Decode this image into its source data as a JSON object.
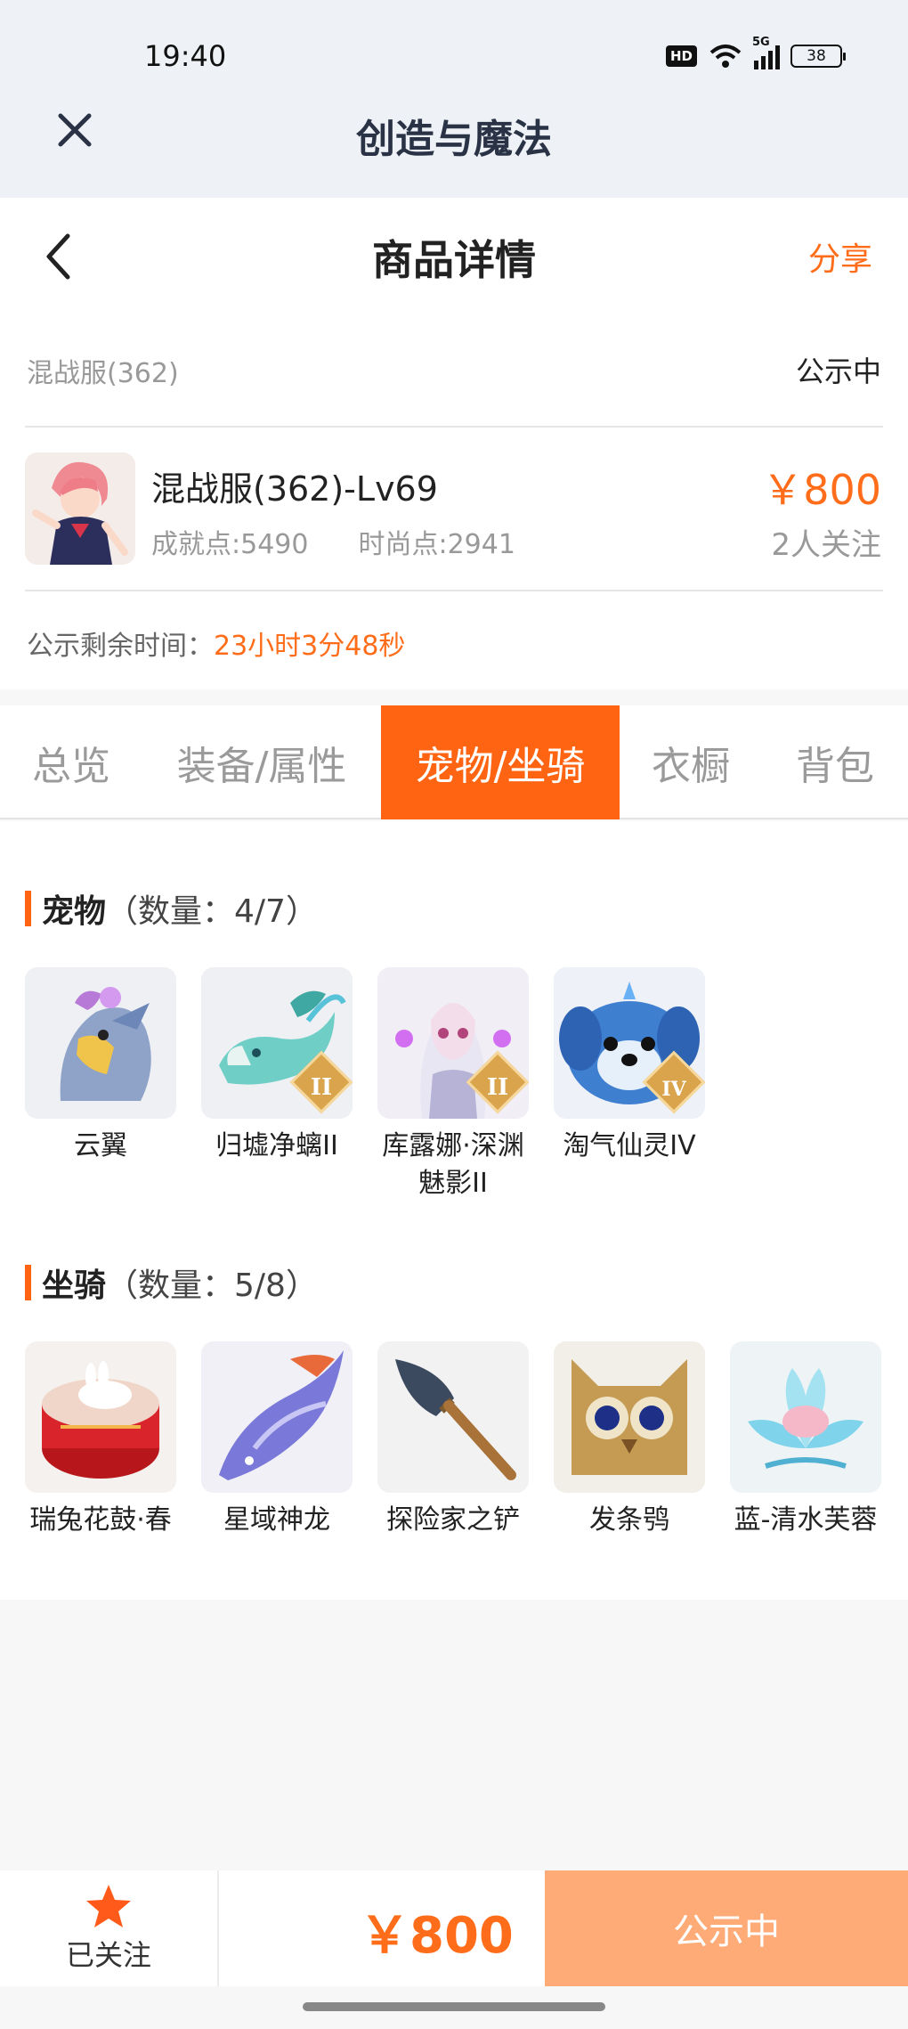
{
  "status_bar": {
    "time": "19:40",
    "hd_badge": "HD",
    "signal_label": "5G",
    "battery": "38"
  },
  "app_bar": {
    "title": "创造与魔法"
  },
  "header": {
    "title": "商品详情",
    "share_label": "分享"
  },
  "listing": {
    "server": "混战服(362)",
    "status": "公示中",
    "character_name": "混战服(362)-Lv69",
    "achievement": "成就点:5490",
    "fashion": "时尚点:2941",
    "price": "￥800",
    "followers": "2人关注",
    "remaining_label": "公示剩余时间：",
    "remaining_value": "23小时3分48秒"
  },
  "tabs": [
    {
      "label": "总览"
    },
    {
      "label": "装备/属性"
    },
    {
      "label": "宠物/坐骑",
      "active": true
    },
    {
      "label": "衣橱"
    },
    {
      "label": "背包"
    }
  ],
  "pets": {
    "title": "宠物",
    "count": "（数量：4/7）",
    "items": [
      {
        "name": "云翼",
        "icon": "griffin-icon"
      },
      {
        "name": "归墟净螭II",
        "icon": "jade-dragon-icon",
        "rank": "II"
      },
      {
        "name": "库露娜·深渊魅影II",
        "icon": "abyss-spirit-icon",
        "rank": "II"
      },
      {
        "name": "淘气仙灵IV",
        "icon": "blue-pup-icon",
        "rank": "IV"
      }
    ]
  },
  "mounts": {
    "title": "坐骑",
    "count": "（数量：5/8）",
    "items": [
      {
        "name": "瑞兔花鼓·春",
        "icon": "rabbit-drum-icon"
      },
      {
        "name": "星域神龙",
        "icon": "star-dragon-icon"
      },
      {
        "name": "探险家之铲",
        "icon": "shovel-icon"
      },
      {
        "name": "发条鸮",
        "icon": "clockwork-owl-icon"
      },
      {
        "name": "蓝-清水芙蓉",
        "icon": "blue-lotus-icon"
      }
    ]
  },
  "bottom_bar": {
    "follow_label": "已关注",
    "price": "￥800",
    "action_label": "公示中"
  },
  "colors": {
    "accent": "#ff6412",
    "price": "#ff6d1a",
    "action_button": "#ffab78"
  }
}
